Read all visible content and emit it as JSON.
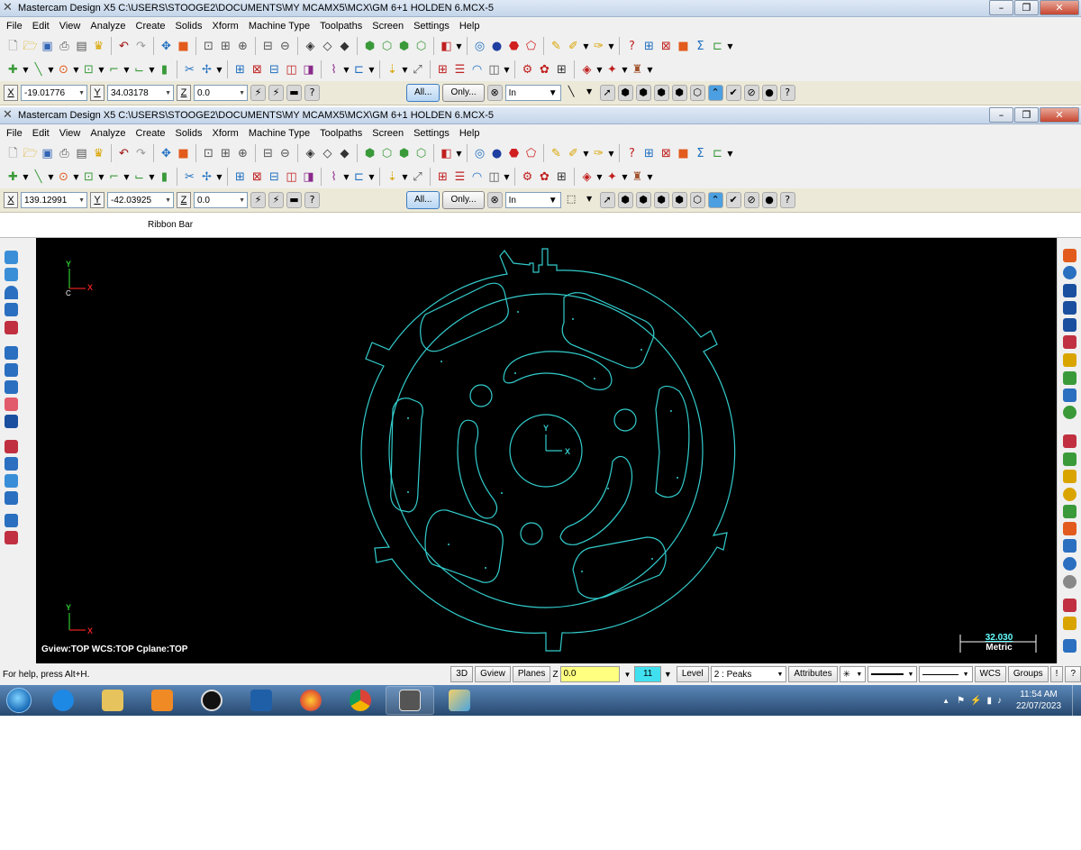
{
  "windows": [
    {
      "title": "Mastercam Design X5  C:\\USERS\\STOOGE2\\DOCUMENTS\\MY MCAMX5\\MCX\\GM 6+1 HOLDEN 6.MCX-5",
      "ribbon": {
        "x_label": "X",
        "x_value": "-19.01776",
        "y_label": "Y",
        "y_value": "34.03178",
        "z_label": "Z",
        "z_value": "0.0"
      }
    },
    {
      "title": "Mastercam Design X5  C:\\USERS\\STOOGE2\\DOCUMENTS\\MY MCAMX5\\MCX\\GM 6+1 HOLDEN 6.MCX-5",
      "ribbon": {
        "x_label": "X",
        "x_value": "139.12991",
        "y_label": "Y",
        "y_value": "-42.03925",
        "z_label": "Z",
        "z_value": "0.0"
      }
    }
  ],
  "menu": [
    "File",
    "Edit",
    "View",
    "Analyze",
    "Create",
    "Solids",
    "Xform",
    "Machine Type",
    "Toolpaths",
    "Screen",
    "Settings",
    "Help"
  ],
  "ribbon_common": {
    "all_button": "All...",
    "only_button": "Only...",
    "mode_value": "In"
  },
  "ribbon_bar_label": "Ribbon Bar",
  "viewport": {
    "status": "Gview:TOP   WCS:TOP   Cplane:TOP",
    "axis_x": "X",
    "axis_y": "Y",
    "axis_c": "C",
    "scale_value": "32.030",
    "scale_units": "Metric",
    "geometry_color": "#33cccc"
  },
  "statusbar": {
    "help": "For help, press Alt+H.",
    "btn_3d": "3D",
    "btn_gview": "Gview",
    "btn_planes": "Planes",
    "z_label": "Z",
    "z_value": "0.0",
    "color_value": "11",
    "level_label": "Level",
    "level_value": "2 : Peaks",
    "attributes": "Attributes",
    "wcs": "WCS",
    "groups": "Groups"
  },
  "taskbar": {
    "time": "11:54 AM",
    "date": "22/07/2023",
    "apps": [
      "internet-explorer",
      "file-explorer",
      "media-player",
      "hp",
      "task-app",
      "firefox",
      "chrome",
      "mastercam",
      "paint"
    ]
  }
}
